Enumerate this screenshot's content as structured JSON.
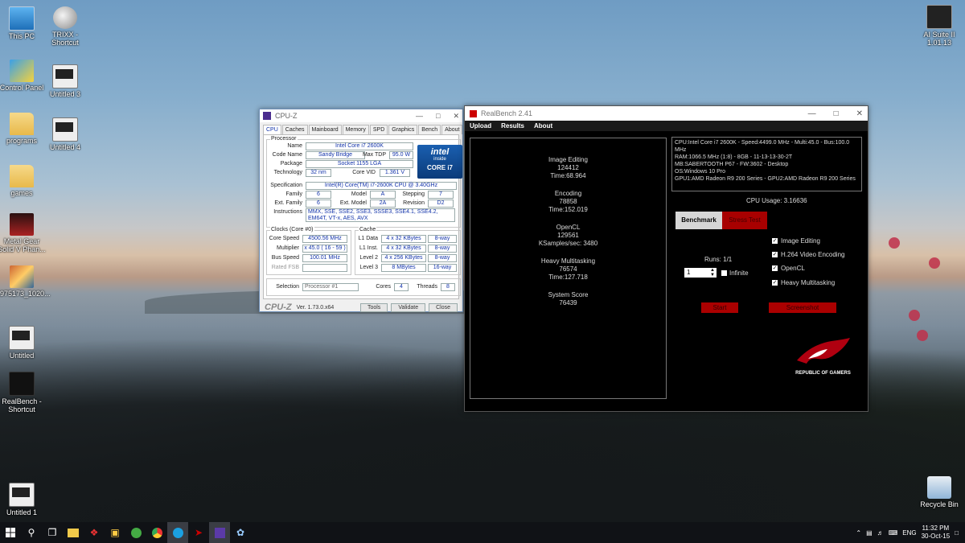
{
  "desktop_icons": [
    {
      "label": "This PC"
    },
    {
      "label": "TRIXX - Shortcut"
    },
    {
      "label": "Control Panel"
    },
    {
      "label": "Untitled 3"
    },
    {
      "label": "programs"
    },
    {
      "label": "Untitled 4"
    },
    {
      "label": "games"
    },
    {
      "label": "Metal Gear Solid V Phan..."
    },
    {
      "label": "1975173_1020..."
    },
    {
      "label": "Untitled"
    },
    {
      "label": "RealBench - Shortcut"
    },
    {
      "label": "Untitled 1"
    },
    {
      "label": "AI Suite II 1.01.13"
    },
    {
      "label": "Recycle Bin"
    }
  ],
  "cpuz": {
    "title": "CPU-Z",
    "tabs": [
      "CPU",
      "Caches",
      "Mainboard",
      "Memory",
      "SPD",
      "Graphics",
      "Bench",
      "About"
    ],
    "processor_group": "Processor",
    "name_label": "Name",
    "name": "Intel Core i7 2600K",
    "codename_label": "Code Name",
    "codename": "Sandy Bridge",
    "maxtdp_label": "Max TDP",
    "maxtdp": "95.0 W",
    "package_label": "Package",
    "package": "Socket 1155 LGA",
    "tech_label": "Technology",
    "tech": "32 nm",
    "corevid_label": "Core VID",
    "corevid": "1.361 V",
    "spec_label": "Specification",
    "spec": "Intel(R) Core(TM) i7-2600K CPU @ 3.40GHz",
    "family_label": "Family",
    "family": "6",
    "model_label": "Model",
    "model": "A",
    "stepping_label": "Stepping",
    "stepping": "7",
    "extfamily_label": "Ext. Family",
    "extfamily": "6",
    "extmodel_label": "Ext. Model",
    "extmodel": "2A",
    "revision_label": "Revision",
    "revision": "D2",
    "instr_label": "Instructions",
    "instr": "MMX, SSE, SSE2, SSE3, SSSE3, SSE4.1, SSE4.2, EM64T, VT-x, AES, AVX",
    "intel_brand": "intel",
    "intel_inside": "inside",
    "intel_core": "CORE i7",
    "clocks_group": "Clocks (Core #0)",
    "corespeed_label": "Core Speed",
    "corespeed": "4500.56 MHz",
    "multiplier_label": "Multiplier",
    "multiplier": "x 45.0 ( 16 - 59 )",
    "busspeed_label": "Bus Speed",
    "busspeed": "100.01 MHz",
    "ratedfsb_label": "Rated FSB",
    "cache_group": "Cache",
    "l1d_label": "L1 Data",
    "l1d": "4 x 32 KBytes",
    "l1d_way": "8-way",
    "l1i_label": "L1 Inst.",
    "l1i": "4 x 32 KBytes",
    "l1i_way": "8-way",
    "l2_label": "Level 2",
    "l2": "4 x 256 KBytes",
    "l2_way": "8-way",
    "l3_label": "Level 3",
    "l3": "8 MBytes",
    "l3_way": "16-way",
    "selection_label": "Selection",
    "selection": "Processor #1",
    "cores_label": "Cores",
    "cores": "4",
    "threads_label": "Threads",
    "threads": "8",
    "logo": "CPU-Z",
    "version": "Ver. 1.73.0.x64",
    "tools_btn": "Tools",
    "validate_btn": "Validate",
    "close_btn": "Close"
  },
  "realbench": {
    "title": "RealBench 2.41",
    "menu": [
      "Upload",
      "Results",
      "About"
    ],
    "results": [
      {
        "name": "Image Editing",
        "score": "124412",
        "time": "Time:68.964"
      },
      {
        "name": "Encoding",
        "score": "78858",
        "time": "Time:152.019"
      },
      {
        "name": "OpenCL",
        "score": "129561",
        "time": "KSamples/sec: 3480"
      },
      {
        "name": "Heavy Multitasking",
        "score": "76574",
        "time": "Time:127.718"
      }
    ],
    "system_score_label": "System Score",
    "system_score": "76439",
    "info_lines": [
      "CPU:Intel Core i7 2600K - Speed:4499.0 MHz - Multi:45.0 - Bus:100.0 MHz",
      "RAM:1066.5 MHz (1:8) - 8GB - 11-13-13-30-2T",
      "MB:SABERTOOTH P67 - FW:3602 - Desktop",
      "OS:Windows 10 Pro",
      "GPU1:AMD Radeon R9 200 Series - GPU2:AMD Radeon R9 200 Series"
    ],
    "cpu_usage": "CPU Usage: 3.16636",
    "tab_benchmark": "Benchmark",
    "tab_stress": "Stress Test",
    "checks": [
      "Image Editing",
      "H.264 Video Encoding",
      "OpenCL",
      "Heavy Multitasking"
    ],
    "runs": "Runs: 1/1",
    "runs_value": "1",
    "infinite": "Infinite",
    "start_btn": "Start",
    "screenshot_btn": "Screenshot",
    "rog_text": "REPUBLIC OF GAMERS"
  },
  "taskbar": {
    "lang": "ENG",
    "time": "11:32 PM",
    "date": "30-Oct-15"
  }
}
